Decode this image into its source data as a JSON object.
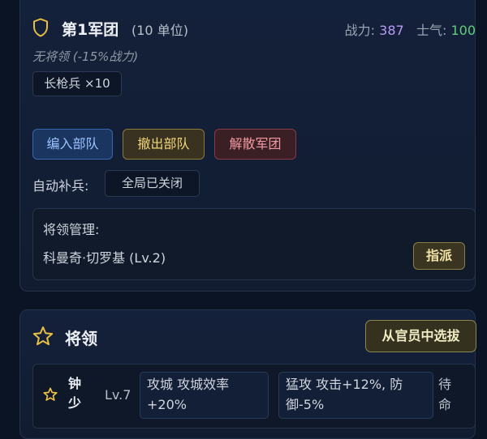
{
  "legion": {
    "title": "第1军团",
    "unit_count": "(10 单位)",
    "power_label": "战力:",
    "power_value": "387",
    "morale_label": "士气:",
    "morale_value": "100",
    "no_general_note": "无将领 (-15%战力)",
    "troop_tag": "长枪兵 ×10",
    "buttons": {
      "assign": "编入部队",
      "withdraw": "撤出部队",
      "disband": "解散军团"
    },
    "auto_reinforce_label": "自动补兵:",
    "auto_reinforce_value": "全局已关闭",
    "general_management": {
      "title": "将领管理:",
      "candidate": "科曼奇·切罗基 (Lv.2)",
      "appoint_button": "指派"
    }
  },
  "generals": {
    "title": "将领",
    "select_button": "从官员中选拔",
    "rows": [
      {
        "name": "钟少",
        "level": "Lv.7",
        "skill1": "攻城 攻城效率+20%",
        "skill2": "猛攻 攻击+12%, 防御-5%",
        "status": "待命"
      }
    ]
  },
  "colors": {
    "accent_gold": "#e9c046",
    "power": "#b79cf2",
    "morale": "#5fcf78"
  },
  "icons": {
    "legion": "shield-icon",
    "generals": "star-icon"
  }
}
